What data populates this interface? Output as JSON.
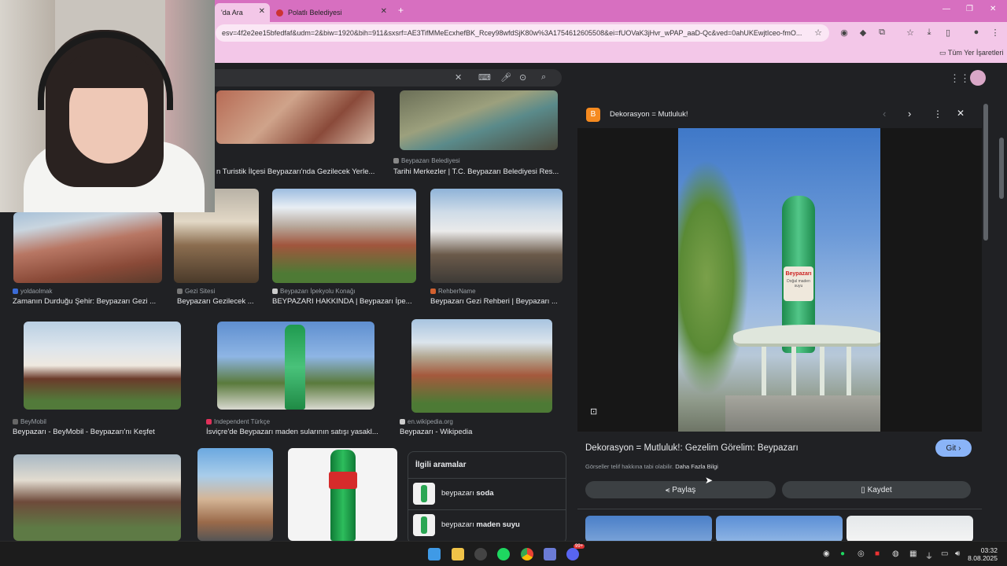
{
  "browser": {
    "tabs": [
      {
        "label": "'da Ara",
        "active": true
      },
      {
        "label": "Polatlı Belediyesi",
        "active": false
      }
    ],
    "url": "esv=4f2e2ee15bfedfaf&udm=2&biw=1920&bih=911&sxsrf=AE3TifMMeEcxhefBK_Rcey98wfdSjK80w%3A1754612605508&ei=fUOVaK3jHvr_wPAP_aaD-Qc&ved=0ahUKEwjtIceo-fmO...",
    "bookmarks_label": "Tüm Yer İşaretleri",
    "new_tab": "+"
  },
  "results": [
    {
      "source": "",
      "title": "n Turistik İlçesi Beypazarı'nda Gezilecek Yerle..."
    },
    {
      "source": "Beypazarı Belediyesi",
      "title": "Tarihi Merkezler | T.C. Beypazarı Belediyesi Res..."
    },
    {
      "source": "yoldaolmak",
      "title": "Zamanın Durduğu Şehir: Beypazarı Gezi ..."
    },
    {
      "source": "Gezi Sitesi",
      "title": "Beypazarı Gezilecek ..."
    },
    {
      "source": "Beypazarı İpekyolu Konağı",
      "title": "BEYPAZARI HAKKINDA | Beypazarı İpe..."
    },
    {
      "source": "RehberName",
      "title": "Beypazarı Gezi Rehberi | Beypazarı ..."
    },
    {
      "source": "BeyMobil",
      "title": "Beypazarı - BeyMobil - Beypazarı'nı Keşfet"
    },
    {
      "source": "Independent Türkçe",
      "title": "İsviçre'de Beypazarı maden sularının satışı yasakl..."
    },
    {
      "source": "en.wikipedia.org",
      "title": "Beypazarı - Wikipedia"
    }
  ],
  "related": {
    "heading": "İlgili aramalar",
    "items": [
      {
        "prefix": "beypazarı ",
        "bold": "soda"
      },
      {
        "prefix": "beypazarı ",
        "bold": "maden suyu"
      }
    ]
  },
  "panel": {
    "site_name": "Dekorasyon = Mutluluk!",
    "title": "Dekorasyon = Mutluluk!: Gezelim Görelim: Beypazarı",
    "go_label": "Git",
    "copyright_text": "Görseller telif hakkına tabi olabilir.",
    "more_info": "Daha Fazla Bilgi",
    "share_label": "Paylaş",
    "save_label": "Kaydet",
    "bottle_text": "Beypazarı",
    "bottle_sub": "Doğal maden suyu"
  },
  "taskbar": {
    "time": "03:32",
    "date": "8.08.2025",
    "badge": "99+"
  },
  "colors": {
    "tabbar": "#d76fc0",
    "toolbar": "#f3c7e8",
    "page_bg": "#202124",
    "accent": "#8ab4f8"
  }
}
